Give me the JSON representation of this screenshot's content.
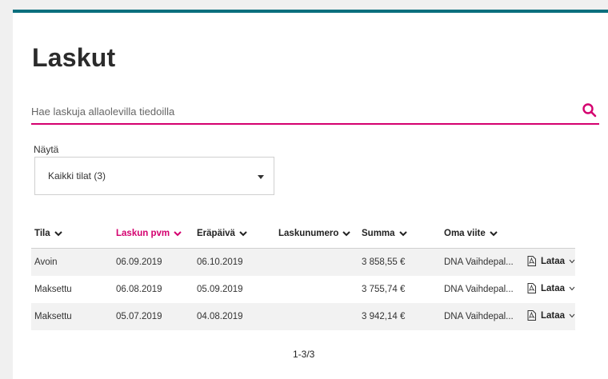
{
  "page": {
    "title": "Laskut"
  },
  "search": {
    "placeholder": "Hae laskuja allaolevilla tiedoilla",
    "value": ""
  },
  "filter": {
    "label": "Näytä",
    "selected": "Kaikki tilat (3)"
  },
  "table": {
    "columns": [
      {
        "label": "Tila",
        "active": false
      },
      {
        "label": "Laskun pvm",
        "active": true
      },
      {
        "label": "Eräpäivä",
        "active": false
      },
      {
        "label": "Laskunumero",
        "active": false
      },
      {
        "label": "Summa",
        "active": false
      },
      {
        "label": "Oma viite",
        "active": false
      }
    ],
    "download_label": "Lataa",
    "rows": [
      {
        "tila": "Avoin",
        "pvm": "06.09.2019",
        "erapaiva": "06.10.2019",
        "laskunumero": "",
        "summa": "3 858,55 €",
        "viite": "DNA Vaihdepal..."
      },
      {
        "tila": "Maksettu",
        "pvm": "06.08.2019",
        "erapaiva": "05.09.2019",
        "laskunumero": "",
        "summa": "3 755,74 €",
        "viite": "DNA Vaihdepal..."
      },
      {
        "tila": "Maksettu",
        "pvm": "05.07.2019",
        "erapaiva": "04.08.2019",
        "laskunumero": "",
        "summa": "3 942,14 €",
        "viite": "DNA Vaihdepal..."
      }
    ]
  },
  "pagination": {
    "text": "1-3/3"
  },
  "colors": {
    "accent": "#d4006f",
    "top_bar": "#0a6f7d",
    "row_alt": "#f2f2f2"
  }
}
